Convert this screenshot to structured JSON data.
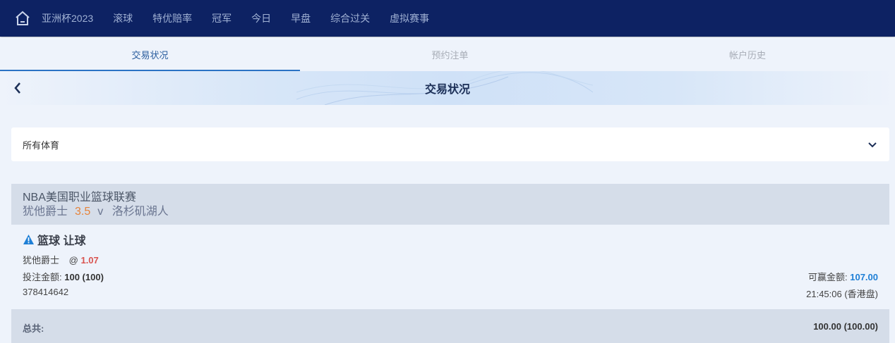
{
  "topnav": {
    "items": [
      "亚洲杯2023",
      "滚球",
      "特优赔率",
      "冠军",
      "今日",
      "早盘",
      "综合过关",
      "虚拟赛事"
    ]
  },
  "tabs": [
    "交易状况",
    "预约注单",
    "帐户历史"
  ],
  "banner": {
    "title": "交易状况"
  },
  "filter": {
    "selected": "所有体育"
  },
  "league": {
    "name": "NBA美国职业篮球联赛",
    "home": "犹他爵士",
    "handicap": "3.5",
    "vs": "v",
    "away": "洛杉矶湖人"
  },
  "bet": {
    "type": "篮球 让球",
    "selection": "犹他爵士",
    "at": "@",
    "odds": "1.07",
    "stake_label": "投注金额:",
    "stake_value": "100 (100)",
    "id": "378414642",
    "win_label": "可赢金额:",
    "win_value": "107.00",
    "time": "21:45:06 (香港盘)"
  },
  "total": {
    "label": "总共:",
    "value": "100.00 (100.00)"
  },
  "colors": {
    "nav_bg": "#0d2263",
    "accent": "#2b73c4",
    "odds": "#d9534f",
    "handicap": "#e6833a"
  },
  "icons": [
    "home-icon",
    "back-icon",
    "chevron-down-icon",
    "warning-icon"
  ]
}
